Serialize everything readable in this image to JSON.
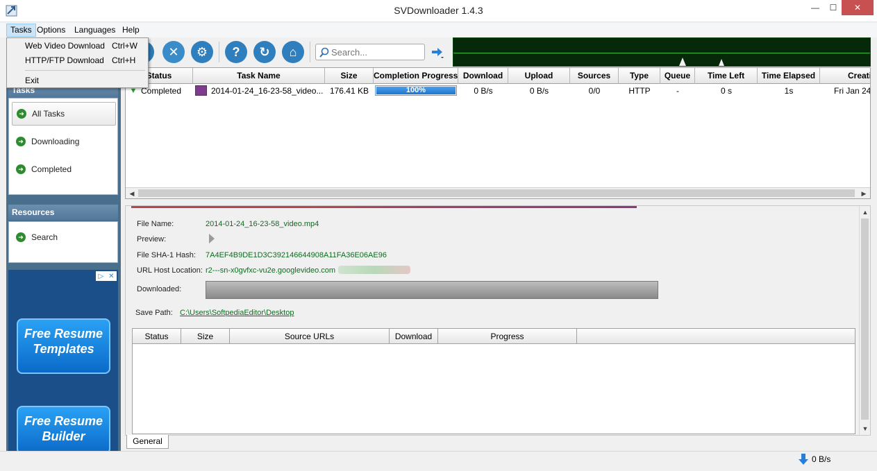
{
  "window": {
    "title": "SVDownloader 1.4.3",
    "minimize": "—",
    "maximize": "☐",
    "close": "✕"
  },
  "menu": {
    "items": [
      "Tasks",
      "Options",
      "Languages",
      "Help"
    ]
  },
  "tasks_menu": {
    "items": [
      {
        "label": "Web Video Download",
        "shortcut": "Ctrl+W"
      },
      {
        "label": "HTTP/FTP Download",
        "shortcut": "Ctrl+H"
      },
      {
        "label": "Exit",
        "shortcut": ""
      }
    ]
  },
  "toolbar": {
    "search_placeholder": "Search..."
  },
  "sidebar": {
    "tasks_header": "Tasks",
    "task_items": [
      "All Tasks",
      "Downloading",
      "Completed"
    ],
    "resources_header": "Resources",
    "resource_items": [
      "Search"
    ]
  },
  "ad": {
    "buttons": [
      "Free Resume Templates",
      "Free Resume Builder"
    ]
  },
  "task_table": {
    "columns": [
      "Status",
      "Task Name",
      "Size",
      "Completion Progress",
      "Download",
      "Upload",
      "Sources",
      "Type",
      "Queue",
      "Time Left",
      "Time Elapsed",
      "Creati"
    ],
    "rows": [
      {
        "status": "Completed",
        "task_name": "2014-01-24_16-23-58_video....",
        "size": "176.41 KB",
        "progress_label": "100%",
        "progress": 100,
        "download": "0 B/s",
        "upload": "0 B/s",
        "sources": "0/0",
        "type": "HTTP",
        "queue": "-",
        "time_left": "0 s",
        "time_elapsed": "1s",
        "created": "Fri Jan 24"
      }
    ]
  },
  "details": {
    "file_name_label": "File Name:",
    "file_name": "2014-01-24_16-23-58_video.mp4",
    "preview_label": "Preview:",
    "sha_label": "File SHA-1 Hash:",
    "sha": "7A4EF4B9DE1D3C392146644908A11FA36E06AE96",
    "host_label": "URL Host Location:",
    "host": "r2---sn-x0gvfxc-vu2e.googlevideo.com",
    "downloaded_label": "Downloaded:",
    "save_path_label": "Save Path:",
    "save_path": "C:\\Users\\SoftpediaEditor\\Desktop"
  },
  "source_table": {
    "columns": [
      "Status",
      "Size",
      "Source URLs",
      "Download",
      "Progress"
    ]
  },
  "tabs": {
    "general": "General"
  },
  "status": {
    "speed": "0 B/s"
  },
  "colors": {
    "graph_bg": "#062a09",
    "sidebar_bg": "#4a6f8d",
    "progress": "#1f74d0",
    "value_text": "#0d6b1f"
  }
}
